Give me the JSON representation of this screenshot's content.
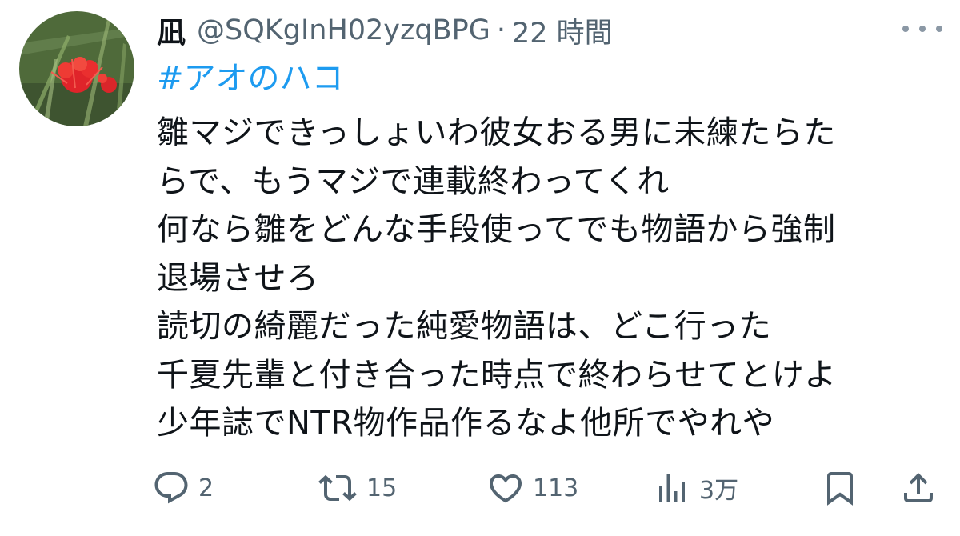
{
  "user": {
    "display_name": "凪",
    "handle": "@SQKgInH02yzqBPG",
    "separator": "·",
    "time": "22 時間"
  },
  "tweet": {
    "hashtag": "#アオのハコ",
    "lines": [
      "雛マジできっしょいわ彼女おる男に未練たらた",
      "らで、もうマジで連載終わってくれ",
      "何なら雛をどんな手段使ってでも物語から強制",
      "退場させろ",
      "読切の綺麗だった純愛物語は、どこ行った",
      "千夏先輩と付き合った時点で終わらせてとけよ",
      "少年誌でNTR物作品作るなよ他所でやれや"
    ]
  },
  "actions": {
    "reply": {
      "icon": "reply-icon",
      "count": "2"
    },
    "retweet": {
      "icon": "retweet-icon",
      "count": "15"
    },
    "like": {
      "icon": "heart-icon",
      "count": "113"
    },
    "views": {
      "icon": "views-icon",
      "count": "3万"
    },
    "bookmark": {
      "icon": "bookmark-icon"
    },
    "share": {
      "icon": "share-icon"
    }
  },
  "colors": {
    "text": "#0f1419",
    "secondary": "#536471",
    "link": "#1d9bf0"
  }
}
